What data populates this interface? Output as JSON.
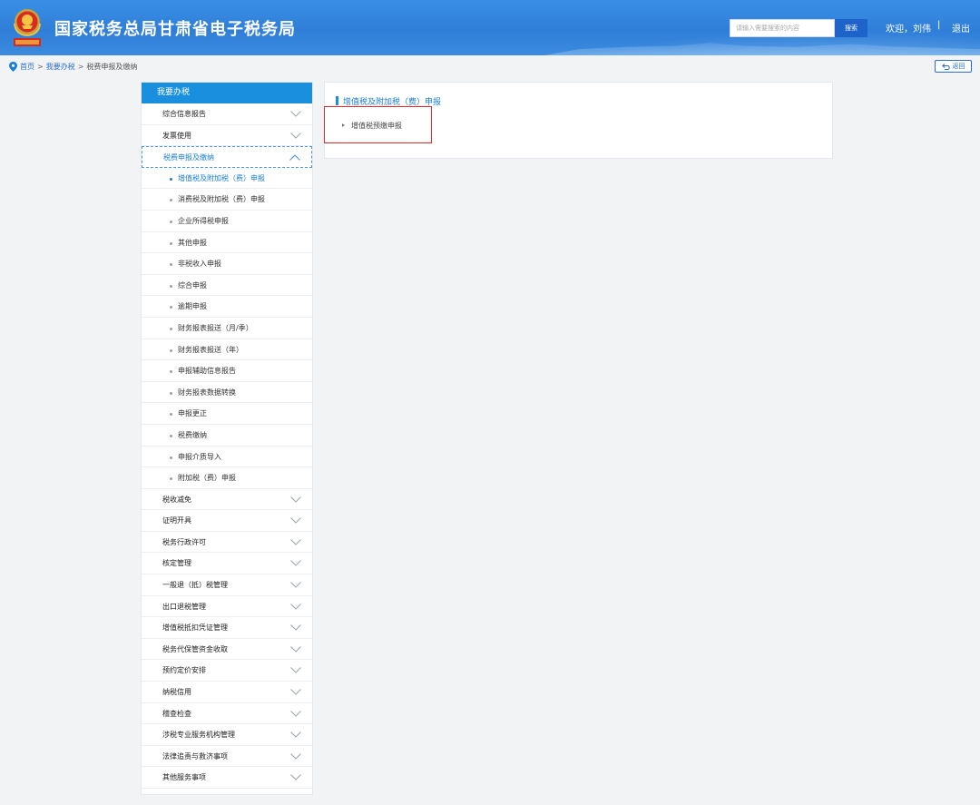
{
  "header": {
    "site_title": "国家税务总局甘肃省电子税务局",
    "search_placeholder": "请输入需要搜索的内容",
    "search_button": "搜索",
    "welcome": "欢迎，刘伟",
    "separator": "|",
    "logout": "退出"
  },
  "breadcrumb": {
    "items": [
      "首页",
      "我要办税",
      "税费申报及缴纳"
    ],
    "separator": ">"
  },
  "back_button": "返回",
  "sidebar": {
    "title": "我要办税",
    "groups_top": [
      "综合信息报告",
      "发票使用"
    ],
    "active_group": "税费申报及缴纳",
    "sub_items": [
      "增值税及附加税（费）申报",
      "消费税及附加税（费）申报",
      "企业所得税申报",
      "其他申报",
      "非税收入申报",
      "综合申报",
      "逾期申报",
      "财务报表报送（月/季）",
      "财务报表报送（年）",
      "申报辅助信息报告",
      "财务报表数据转换",
      "申报更正",
      "税费缴纳",
      "申报介质导入",
      "附加税（费）申报"
    ],
    "current_sub_index": 0,
    "groups_bottom": [
      "税收减免",
      "证明开具",
      "税务行政许可",
      "核定管理",
      "一般退（抵）税管理",
      "出口退税管理",
      "增值税抵扣凭证管理",
      "税务代保管资金收取",
      "预约定价安排",
      "纳税信用",
      "稽查检查",
      "涉税专业服务机构管理",
      "法律追责与救济事项",
      "其他服务事项"
    ]
  },
  "panel": {
    "title": "增值税及附加税（费）申报",
    "items": [
      "增值税预缴申报"
    ]
  },
  "colors": {
    "header_blue": "#2f7ed8",
    "accent_blue": "#1a8fdd",
    "link_blue": "#2a6fd0",
    "highlight_red": "#e02a2a"
  }
}
